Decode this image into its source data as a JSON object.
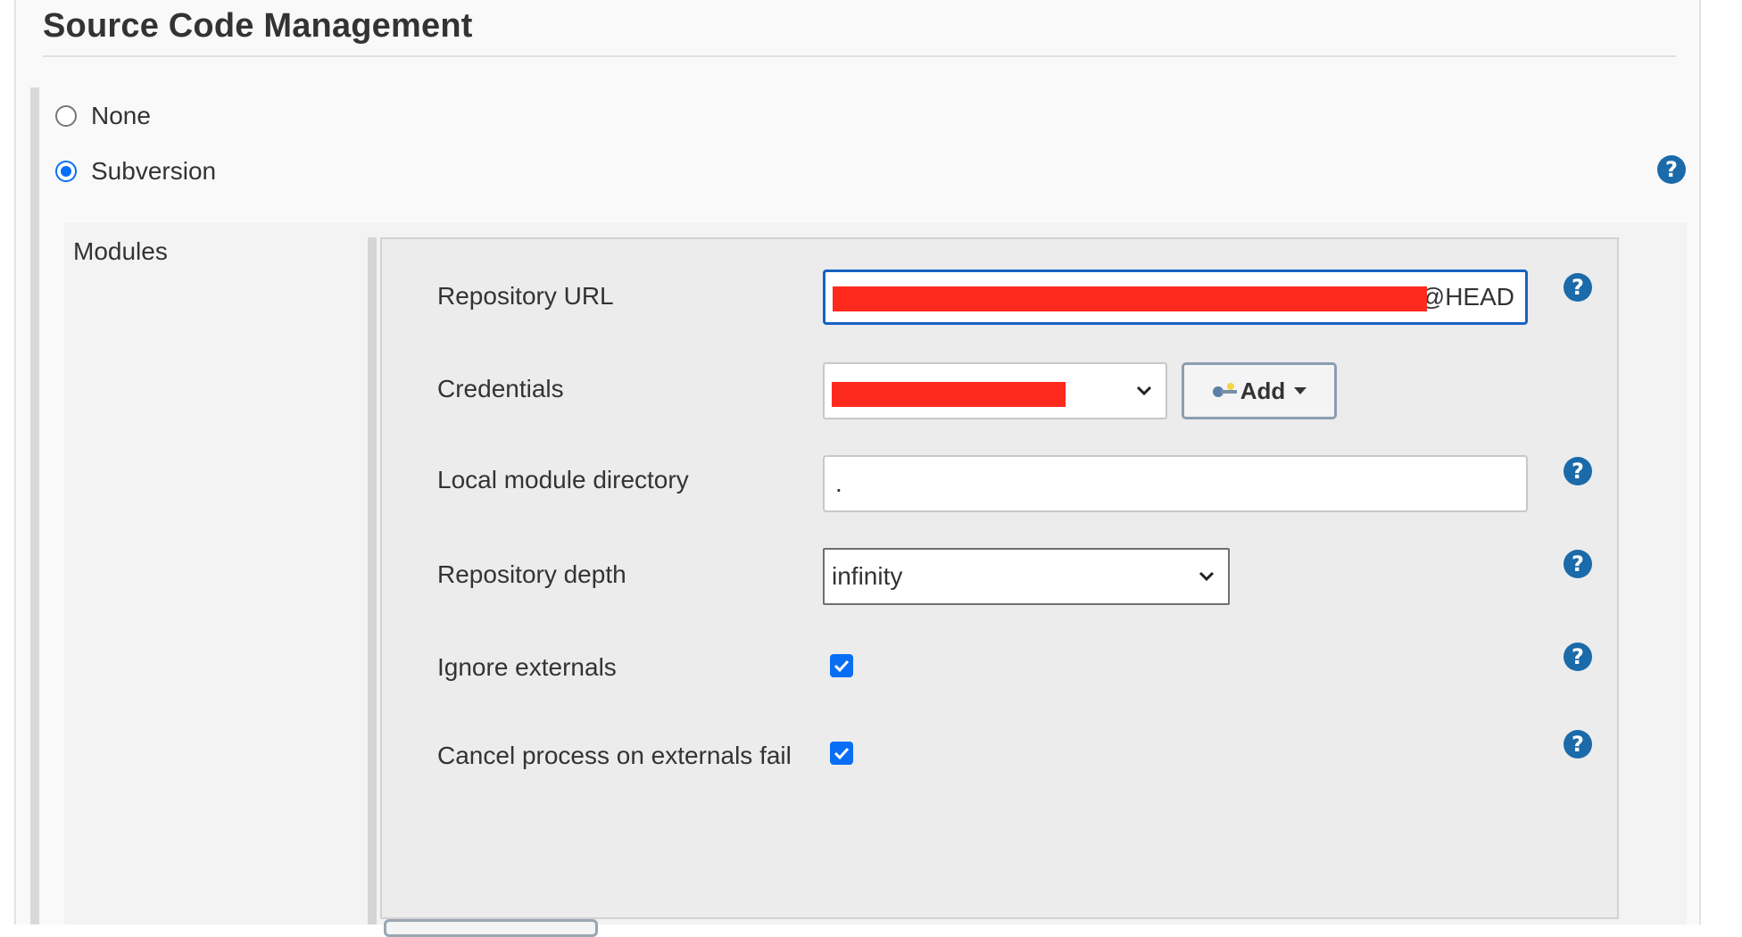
{
  "section": {
    "title": "Source Code Management"
  },
  "scm_options": [
    {
      "label": "None",
      "selected": false
    },
    {
      "label": "Subversion",
      "selected": true
    }
  ],
  "modules": {
    "label": "Modules",
    "repository_url": {
      "label": "Repository URL",
      "value_suffix": "@HEAD",
      "value_redacted": true
    },
    "credentials": {
      "label": "Credentials",
      "value_redacted": true,
      "add_button": "Add"
    },
    "local_module_directory": {
      "label": "Local module directory",
      "value": "."
    },
    "repository_depth": {
      "label": "Repository depth",
      "value": "infinity"
    },
    "ignore_externals": {
      "label": "Ignore externals",
      "checked": true
    },
    "cancel_process_on_externals_fail": {
      "label": "Cancel process on externals fail",
      "checked": true
    }
  },
  "icons": {
    "help": "help-icon",
    "chevron": "chevron-down-icon",
    "key": "key-icon",
    "check": "checkmark-icon"
  },
  "colors": {
    "accent_blue": "#0a6ef5",
    "help_blue": "#1b6aa9",
    "focus_border": "#1762c2",
    "redaction": "#ff2a1e"
  }
}
